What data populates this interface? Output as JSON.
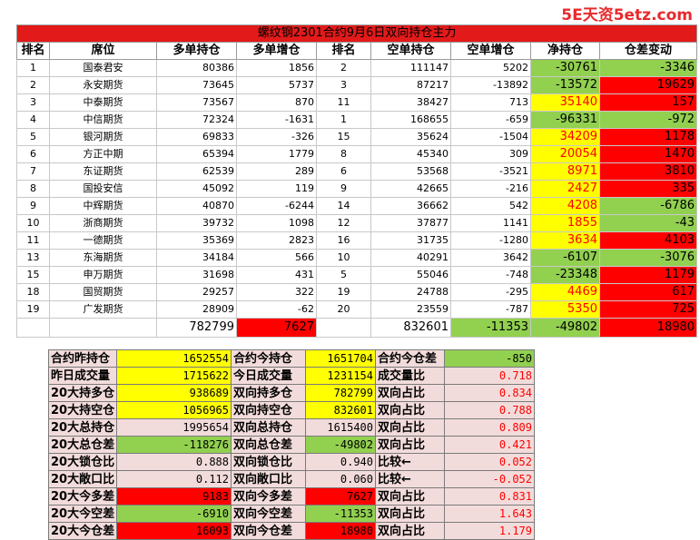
{
  "watermark": "5E天资5etz.com",
  "title": "螺纹钢2301合约9月6日双向持仓主力",
  "headers": [
    "排名",
    "席位",
    "多单持仓",
    "多单增仓",
    "排名",
    "空单持仓",
    "空单增仓",
    "净持仓",
    "仓差变动"
  ],
  "rows": [
    {
      "rank": "1",
      "seat": "国泰君安",
      "long": "80386",
      "long_chg": "1856",
      "srank": "2",
      "short": "111147",
      "short_chg": "5202",
      "net": "-30761",
      "diff": "-3346"
    },
    {
      "rank": "2",
      "seat": "永安期货",
      "long": "73645",
      "long_chg": "5737",
      "srank": "3",
      "short": "87217",
      "short_chg": "-13892",
      "net": "-13572",
      "diff": "19629"
    },
    {
      "rank": "3",
      "seat": "中泰期货",
      "long": "73567",
      "long_chg": "870",
      "srank": "11",
      "short": "38427",
      "short_chg": "713",
      "net": "35140",
      "diff": "157"
    },
    {
      "rank": "4",
      "seat": "中信期货",
      "long": "72324",
      "long_chg": "-1631",
      "srank": "1",
      "short": "168655",
      "short_chg": "-659",
      "net": "-96331",
      "diff": "-972"
    },
    {
      "rank": "5",
      "seat": "银河期货",
      "long": "69833",
      "long_chg": "-326",
      "srank": "15",
      "short": "35624",
      "short_chg": "-1504",
      "net": "34209",
      "diff": "1178"
    },
    {
      "rank": "6",
      "seat": "方正中期",
      "long": "65394",
      "long_chg": "1779",
      "srank": "8",
      "short": "45340",
      "short_chg": "309",
      "net": "20054",
      "diff": "1470"
    },
    {
      "rank": "7",
      "seat": "东证期货",
      "long": "62539",
      "long_chg": "289",
      "srank": "6",
      "short": "53568",
      "short_chg": "-3521",
      "net": "8971",
      "diff": "3810"
    },
    {
      "rank": "8",
      "seat": "国投安信",
      "long": "45092",
      "long_chg": "119",
      "srank": "9",
      "short": "42665",
      "short_chg": "-216",
      "net": "2427",
      "diff": "335"
    },
    {
      "rank": "9",
      "seat": "中辉期货",
      "long": "40870",
      "long_chg": "-6244",
      "srank": "14",
      "short": "36662",
      "short_chg": "542",
      "net": "4208",
      "diff": "-6786"
    },
    {
      "rank": "10",
      "seat": "浙商期货",
      "long": "39732",
      "long_chg": "1098",
      "srank": "12",
      "short": "37877",
      "short_chg": "1141",
      "net": "1855",
      "diff": "-43"
    },
    {
      "rank": "11",
      "seat": "一德期货",
      "long": "35369",
      "long_chg": "2823",
      "srank": "16",
      "short": "31735",
      "short_chg": "-1280",
      "net": "3634",
      "diff": "4103"
    },
    {
      "rank": "13",
      "seat": "东海期货",
      "long": "34184",
      "long_chg": "566",
      "srank": "10",
      "short": "40291",
      "short_chg": "3642",
      "net": "-6107",
      "diff": "-3076"
    },
    {
      "rank": "15",
      "seat": "申万期货",
      "long": "31698",
      "long_chg": "431",
      "srank": "5",
      "short": "55046",
      "short_chg": "-748",
      "net": "-23348",
      "diff": "1179"
    },
    {
      "rank": "18",
      "seat": "国贸期货",
      "long": "29257",
      "long_chg": "322",
      "srank": "19",
      "short": "24788",
      "short_chg": "-295",
      "net": "4469",
      "diff": "617"
    },
    {
      "rank": "19",
      "seat": "广发期货",
      "long": "28909",
      "long_chg": "-62",
      "srank": "20",
      "short": "23559",
      "short_chg": "-787",
      "net": "5350",
      "diff": "725"
    }
  ],
  "totals": {
    "long": "782799",
    "long_chg": "7627",
    "short": "832601",
    "short_chg": "-11353",
    "net": "-49802",
    "diff": "18980"
  },
  "colors": {
    "red": "#ff0000",
    "green": "#92d050",
    "yellow": "#ffff00",
    "pink": "#f2dcdb",
    "title_red": "#e31a1a"
  },
  "summary": [
    [
      "合约昨持仓",
      "1652554",
      "合约今持仓",
      "1651704",
      "合约今仓差",
      "-850"
    ],
    [
      "昨日成交量",
      "1715622",
      "今日成交量",
      "1231154",
      "成交量比",
      "0.718"
    ],
    [
      "20大持多仓",
      "938689",
      "双向持多仓",
      "782799",
      "双向占比",
      "0.834"
    ],
    [
      "20大持空仓",
      "1056965",
      "双向持空仓",
      "832601",
      "双向占比",
      "0.788"
    ],
    [
      "20大总持仓",
      "1995654",
      "双向总持仓",
      "1615400",
      "双向占比",
      "0.809"
    ],
    [
      "20大总仓差",
      "-118276",
      "双向总仓差",
      "-49802",
      "双向占比",
      "0.421"
    ],
    [
      "20大锁仓比",
      "0.888",
      "双向锁仓比",
      "0.940",
      "比较←",
      "0.052"
    ],
    [
      "20大敞口比",
      "0.112",
      "双向敞口比",
      "0.060",
      "比较←",
      "-0.052"
    ],
    [
      "20大今多差",
      "9183",
      "双向今多差",
      "7627",
      "双向占比",
      "0.831"
    ],
    [
      "20大今空差",
      "-6910",
      "双向今空差",
      "-11353",
      "双向占比",
      "1.643"
    ],
    [
      "20大今仓差",
      "16093",
      "双向今仓差",
      "18980",
      "双向占比",
      "1.179"
    ]
  ]
}
